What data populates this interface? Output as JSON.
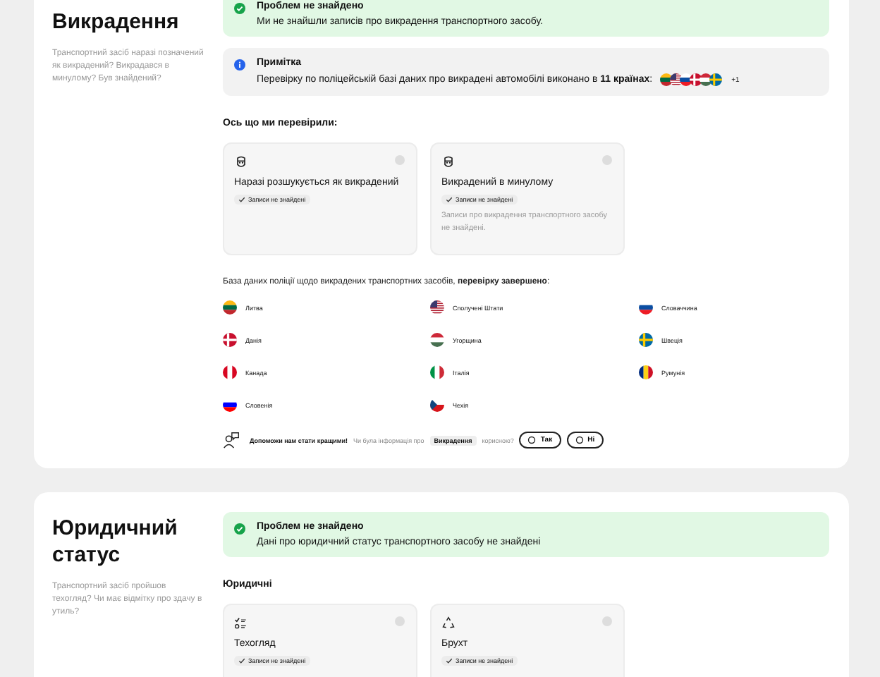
{
  "sections": [
    {
      "title": "Викрадення",
      "subtitle": "Транспортний засіб наразі позначений як викрадений? Викрадався в минулому? Був знайдений?",
      "alerts": [
        {
          "kind": "success",
          "title": "Проблем не знайдено",
          "text": "Ми не знайшли записів про викрадення транспортного засобу."
        },
        {
          "kind": "info",
          "title": "Примітка",
          "text": "Перевірку по поліцейській базі даних про викрадені автомобілі виконано в **11 країнах**:",
          "more": "+1"
        }
      ],
      "group_label": "Ось що ми перевірили:",
      "checks": [
        {
          "title": "Наразі розшукується як викрадений",
          "status": "Записи не знайдені"
        },
        {
          "title": "Викрадений в минулому",
          "status": "Записи не знайдені",
          "note": "Записи про викрадення транспортного засобу не знайдені."
        }
      ],
      "countries_label": "База даних поліції щодо викрадених транспортних засобів, **перевірку завершено**:",
      "countries": [
        "Литва",
        "Сполучені Штати",
        "Словаччина",
        "Данія",
        "Угорщина",
        "Швеція",
        "Канада",
        "Італія",
        "Румунія",
        "Словенія",
        "Чехія"
      ],
      "feedback": {
        "title": "Допоможи нам стати кращими!",
        "before": "Чи була інформація про",
        "topic": "Викрадення",
        "after": "корисною?",
        "options": [
          "Так",
          "Ні"
        ]
      }
    },
    {
      "title": "Юридичний статус",
      "subtitle": "Транспортний засіб пройшов техогляд? Чи має відмітку про здачу в утиль?",
      "alerts": [
        {
          "kind": "success",
          "title": "Проблем не знайдено",
          "text": "Дані про юридичний статус транспортного засобу не знайдені"
        }
      ],
      "group_label": "Юридичні",
      "checks": [
        {
          "title": "Техогляд",
          "status": "Записи не знайдені"
        },
        {
          "title": "Брухт",
          "status": "Записи не знайдені"
        }
      ]
    }
  ]
}
